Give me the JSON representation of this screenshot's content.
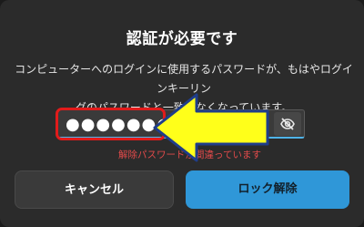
{
  "dialog": {
    "title": "認証が必要です",
    "message_line1": "コンピューターへのログインに使用するパスワードが、もはやログインキーリン",
    "message_line2": "グのパスワードと一致しなくなっています。",
    "password_value": "●●●●●●●●",
    "error_text": "解除パスワードが間違っています",
    "cancel_label": "キャンセル",
    "unlock_label": "ロック解除"
  },
  "colors": {
    "accent": "#2f97d8",
    "error": "#e04a4a",
    "highlight": "#e11b1b",
    "arrow": "#ffff1a"
  }
}
